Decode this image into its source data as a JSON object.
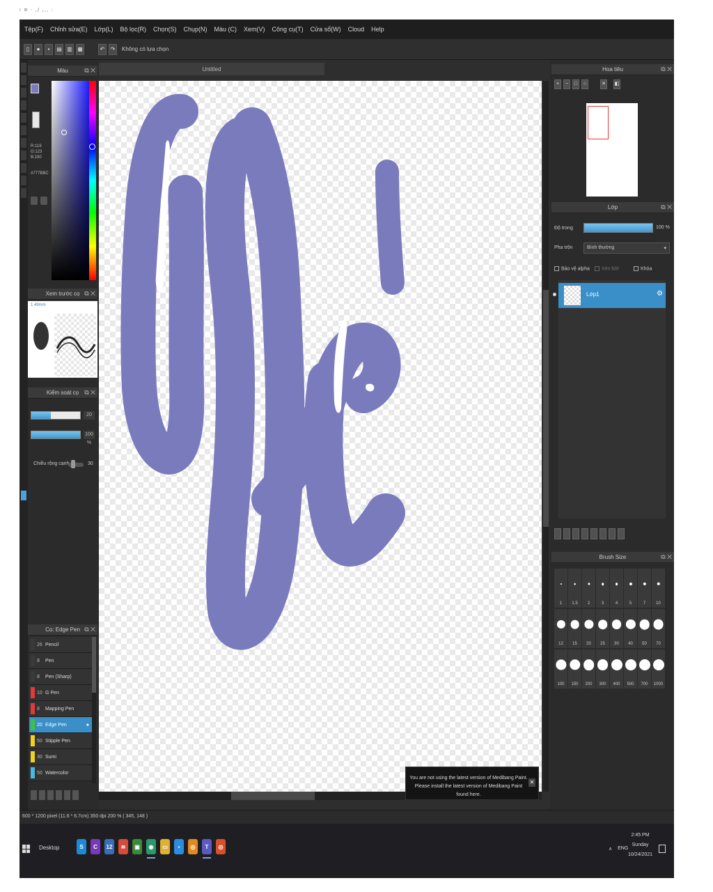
{
  "top_strip": "ı ≡ · ,/ ,,, :",
  "menu": [
    "Tệp(F)",
    "Chỉnh sửa(E)",
    "Lớp(L)",
    "Bộ lọc(R)",
    "Chọn(S)",
    "Chụp(N)",
    "Màu (C)",
    "Xem(V)",
    "Công cụ(T)",
    "Cửa sổ(W)",
    "Cloud",
    "Help"
  ],
  "toolbar": {
    "status_text": "Không có lựa chọn"
  },
  "color_panel": {
    "title": "Màu",
    "values": [
      "R:119",
      "G:123",
      "B:190"
    ],
    "hex": "#777BBC",
    "primary_color": "#7a7bbd"
  },
  "brush_preview": {
    "title": "Xem trước cọ",
    "size_label": "1.49mm"
  },
  "brush_control": {
    "title": "Kiểm soát cọ",
    "size_value": "20",
    "opacity_value": "100 %",
    "edge_label": "Chiều rộng cạnh",
    "edge_value": "30"
  },
  "brushes": {
    "title": "Cọ: Edge Pen",
    "items": [
      {
        "size": "26",
        "name": "Pencil",
        "color": "#3a3a3a"
      },
      {
        "size": "8",
        "name": "Pen",
        "color": "#3a3a3a"
      },
      {
        "size": "8",
        "name": "Pen (Sharp)",
        "color": "#3a3a3a"
      },
      {
        "size": "10",
        "name": "G Pen",
        "color": "#e03a3a"
      },
      {
        "size": "8",
        "name": "Mapping Pen",
        "color": "#e03a3a"
      },
      {
        "size": "20",
        "name": "Edge Pen",
        "color": "#3cc43c",
        "active": true
      },
      {
        "size": "50",
        "name": "Stipple Pen",
        "color": "#f0d020"
      },
      {
        "size": "30",
        "name": "Sumi",
        "color": "#f0d020"
      },
      {
        "size": "50",
        "name": "Watercolor",
        "color": "#4ab8e0"
      }
    ]
  },
  "canvas": {
    "tab_title": "Untitled",
    "stroke_color": "#7a7bbd"
  },
  "notice": {
    "line1": "You are not using the latest version of Medibang Paint.",
    "line2": "Please install the latest version of Medibang Paint found here."
  },
  "navigator": {
    "title": "Hoa tiêu"
  },
  "layers": {
    "title": "Lớp",
    "opacity_label": "Độ trong",
    "opacity_value": "100 %",
    "blend_label": "Pha trộn",
    "blend_value": "Bình thường",
    "protect_alpha": "Bảo vệ alpha",
    "clipping": "Xén bớt",
    "lock": "Khóa",
    "layer_name": "Lớp1"
  },
  "brush_size": {
    "title": "Brush Size",
    "sizes": [
      "1",
      "1.5",
      "2",
      "3",
      "4",
      "5",
      "7",
      "10",
      "12",
      "15",
      "20",
      "25",
      "30",
      "40",
      "50",
      "70",
      "100",
      "150",
      "200",
      "300",
      "400",
      "500",
      "700",
      "1000"
    ]
  },
  "status": "600 * 1200 pixel  (11.6 * 6.7cm)  350 dpi  200 %  ( 345, 148 )",
  "taskbar": {
    "desktop_label": "Desktop",
    "icons": [
      {
        "name": "skype-icon",
        "glyph": "S",
        "color": "#1e8ad6"
      },
      {
        "name": "c-app-icon",
        "glyph": "C",
        "color": "#7a3ab8"
      },
      {
        "name": "calc-icon",
        "glyph": "12",
        "color": "#3a6fb8"
      },
      {
        "name": "wifi-icon",
        "glyph": "≋",
        "color": "#d84a3a"
      },
      {
        "name": "photo-icon",
        "glyph": "▣",
        "color": "#3a8a3a"
      },
      {
        "name": "medibang-icon",
        "glyph": "◉",
        "color": "#2a9a6a"
      },
      {
        "name": "folder-icon",
        "glyph": "▭",
        "color": "#e0b030"
      },
      {
        "name": "zoom-icon",
        "glyph": "▪",
        "color": "#2d8ce0"
      },
      {
        "name": "chrome-icon",
        "glyph": "◎",
        "color": "#e08a20"
      },
      {
        "name": "teams-icon",
        "glyph": "T",
        "color": "#5a5ac0"
      },
      {
        "name": "chrome2-icon",
        "glyph": "◎",
        "color": "#d8502a"
      }
    ],
    "lang": "ENG",
    "time": "2:45 PM",
    "day": "Sunday",
    "date": "10/24/2021"
  }
}
